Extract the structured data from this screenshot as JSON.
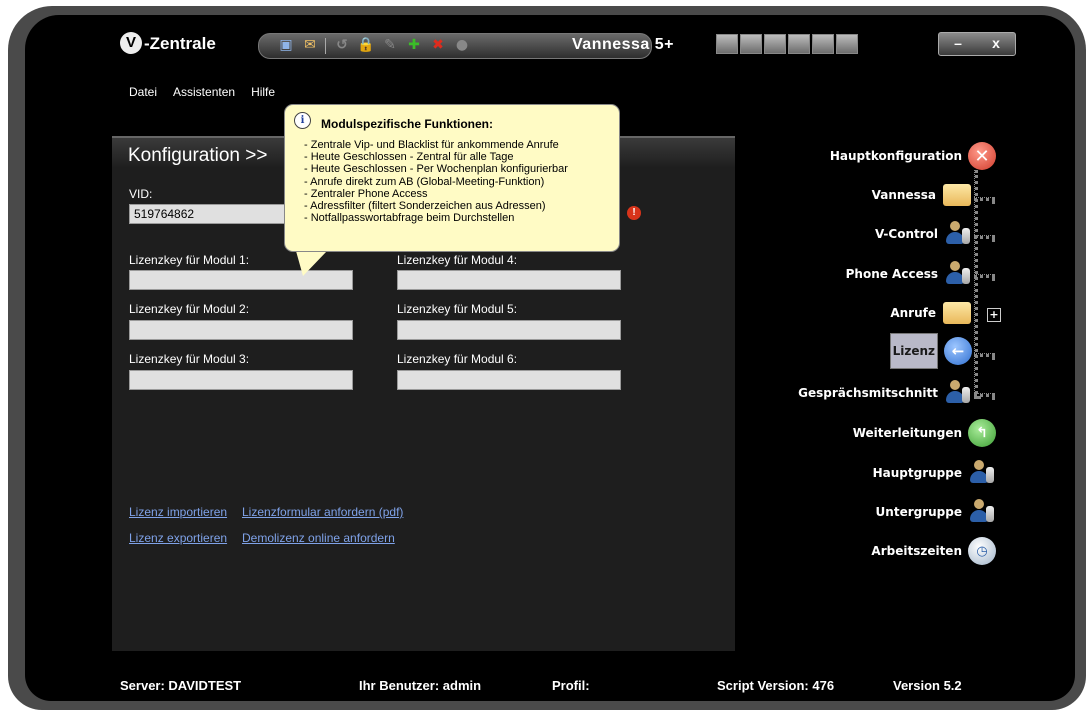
{
  "app": {
    "logo_letter": "V",
    "title": "-Zentrale",
    "window_title": "Vannessa 5+",
    "minimize_label": "–",
    "close_label": "x"
  },
  "toolbar": {
    "icons": [
      "save-icon",
      "open-folder-icon",
      "undo-icon",
      "lock-icon",
      "edit-icon",
      "add-icon",
      "delete-icon",
      "info-icon"
    ],
    "glyphs": [
      "▣",
      "✉",
      "↺",
      "🔒",
      "✎",
      "✚",
      "✖",
      "●"
    ],
    "colors": [
      "#8fb4e8",
      "#f2c266",
      "#888888",
      "#888888",
      "#888888",
      "#3bbd28",
      "#e02b1d",
      "#888888"
    ]
  },
  "menu": {
    "items": [
      "Datei",
      "Assistenten",
      "Hilfe"
    ]
  },
  "panel": {
    "title": "Konfiguration >>",
    "vid_label": "VID:",
    "vid_value": "519764862",
    "modules": [
      {
        "label": "Lizenzkey für Modul 1:",
        "value": ""
      },
      {
        "label": "Lizenzkey für Modul 2:",
        "value": ""
      },
      {
        "label": "Lizenzkey für Modul 3:",
        "value": ""
      },
      {
        "label": "Lizenzkey für Modul 4:",
        "value": ""
      },
      {
        "label": "Lizenzkey für Modul 5:",
        "value": ""
      },
      {
        "label": "Lizenzkey für Modul 6:",
        "value": ""
      }
    ],
    "warning_glyph": "!",
    "links": {
      "import": "Lizenz importieren",
      "form": "Lizenzformular anfordern (pdf)",
      "export": "Lizenz exportieren",
      "demo": "Demolizenz online anfordern"
    }
  },
  "tooltip": {
    "icon_glyph": "i",
    "title": "Modulspezifische Funktionen:",
    "lines": [
      "- Zentrale Vip- und Blacklist für ankommende Anrufe",
      "- Heute Geschlossen - Zentral für alle Tage",
      "- Heute Geschlossen - Per Wochenplan konfigurierbar",
      "- Anrufe direkt zum AB (Global-Meeting-Funktion)",
      "- Zentraler Phone Access",
      "- Adressfilter (filtert Sonderzeichen aus Adressen)",
      "- Notfallpasswortabfrage beim Durchstellen"
    ]
  },
  "sidebar": {
    "items": [
      {
        "label": "Hauptkonfiguration",
        "icon": "close-circle-icon",
        "glyph": "✕"
      },
      {
        "label": "Vannessa",
        "icon": "folder-icon",
        "glyph": ""
      },
      {
        "label": "V-Control",
        "icon": "user-key-icon",
        "glyph": ""
      },
      {
        "label": "Phone Access",
        "icon": "user-key-icon",
        "glyph": ""
      },
      {
        "label": "Anrufe",
        "icon": "folder-icon",
        "glyph": ""
      },
      {
        "label": "Lizenz",
        "icon": "back-arrow-icon",
        "glyph": "←"
      },
      {
        "label": "Gesprächsmitschnitt",
        "icon": "user-key-icon",
        "glyph": ""
      },
      {
        "label": "Weiterleitungen",
        "icon": "redirect-icon",
        "glyph": "↰"
      },
      {
        "label": "Hauptgruppe",
        "icon": "user-key-icon",
        "glyph": ""
      },
      {
        "label": "Untergruppe",
        "icon": "user-key-icon",
        "glyph": ""
      },
      {
        "label": "Arbeitszeiten",
        "icon": "clock-icon",
        "glyph": "◷"
      }
    ],
    "expand_glyph": "+"
  },
  "status": {
    "server": "Server: DAVIDTEST",
    "user": "Ihr Benutzer: admin",
    "profile": "Profil:",
    "script_version": "Script Version: 476",
    "version": "Version 5.2"
  }
}
